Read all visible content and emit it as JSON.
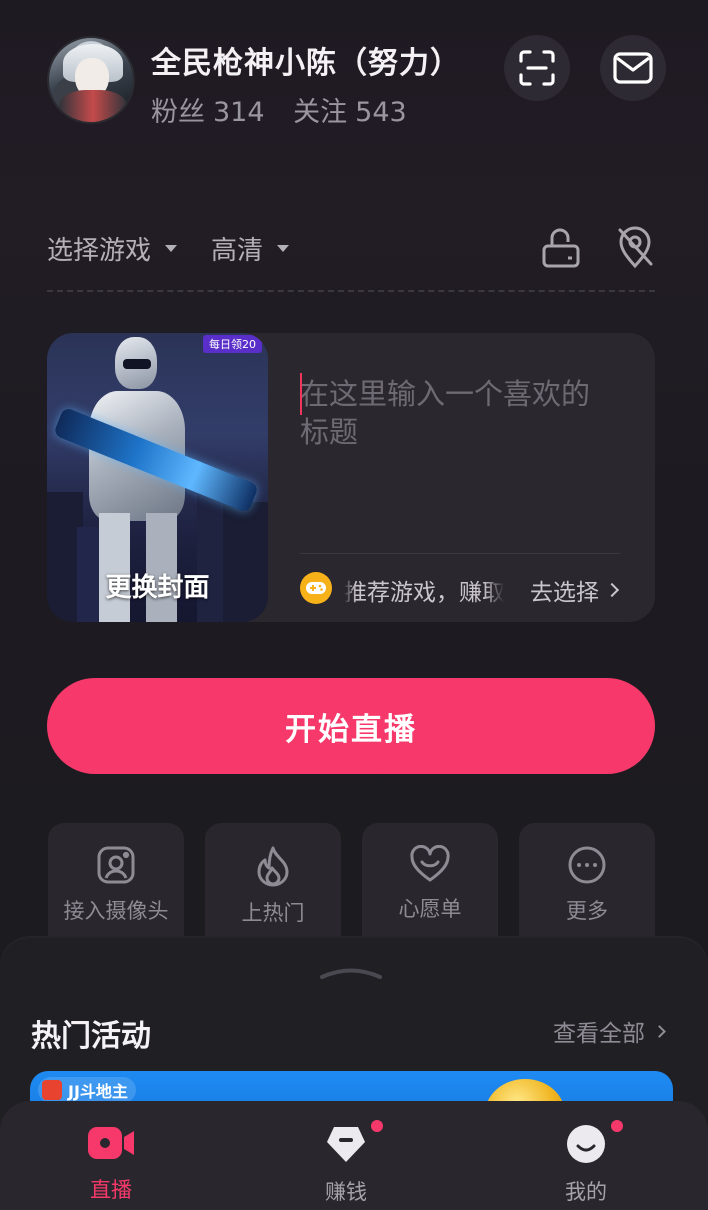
{
  "profile": {
    "username": "全民枪神小陈（努力）",
    "fans_label": "粉丝",
    "fans_count": "314",
    "following_label": "关注",
    "following_count": "543"
  },
  "header_icons": [
    "scan-icon",
    "mail-icon"
  ],
  "settings_row": {
    "game_selector": "选择游戏",
    "quality_selector": "高清",
    "icons": [
      "screen-rotate-icon",
      "location-off-icon"
    ]
  },
  "stream_card": {
    "cover_tag": "每日领20",
    "cover_label": "更换封面",
    "title_placeholder": "在这里输入一个喜欢的标题",
    "title_value": "",
    "recommend_text": "推荐游戏，赚取",
    "go_select_label": "去选择"
  },
  "start_button": "开始直播",
  "tools": [
    {
      "label": "接入摄像头",
      "icon": "camera-icon"
    },
    {
      "label": "上热门",
      "icon": "flame-icon"
    },
    {
      "label": "心愿单",
      "icon": "heart-icon"
    },
    {
      "label": "更多",
      "icon": "more-icon"
    }
  ],
  "hot_activities": {
    "title": "热门活动",
    "see_all": "查看全部",
    "banner_brand": "JJ斗地主"
  },
  "bottom_nav": [
    {
      "label": "直播",
      "icon": "live-camera-icon",
      "active": true,
      "badge": false
    },
    {
      "label": "赚钱",
      "icon": "earn-icon",
      "active": false,
      "badge": true
    },
    {
      "label": "我的",
      "icon": "profile-icon",
      "active": false,
      "badge": true
    }
  ],
  "colors": {
    "accent": "#f6396a",
    "background": "#1c1b20",
    "card": "#2a282e",
    "muted_text": "#8f8b94"
  }
}
